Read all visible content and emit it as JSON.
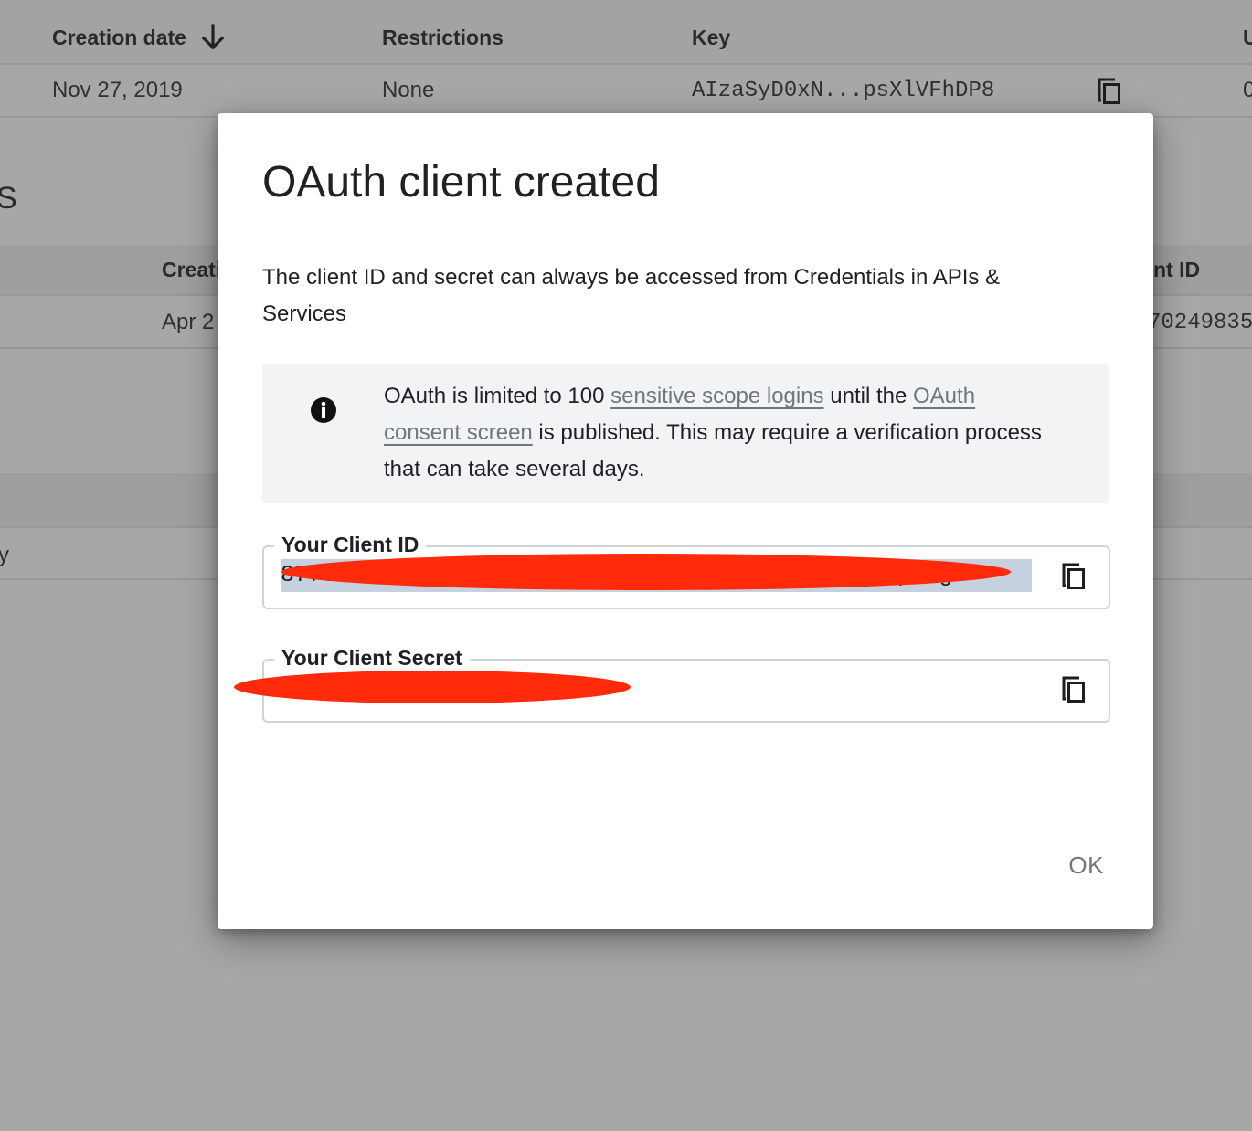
{
  "background": {
    "api_keys_table": {
      "headers": {
        "creation_date": "Creation date",
        "restrictions": "Restrictions",
        "key": "Key",
        "cut_off_column": "U"
      },
      "row": {
        "creation_date": "Nov 27, 2019",
        "restrictions": "None",
        "key": "AIzaSyD0xN...psXlVFhDP8",
        "cut_off_cell": "0"
      }
    },
    "oauth_section": {
      "title_fragment": "S",
      "headers": {
        "creation_fragment": "Creati",
        "client_id_fragment": "nt ID"
      },
      "row": {
        "creation_fragment": "Apr 2",
        "client_id_fragment": "70249835"
      }
    },
    "extra_row_fragment": "y"
  },
  "dialog": {
    "title": "OAuth client created",
    "description": "The client ID and secret can always be accessed from Credentials in APIs & Services",
    "notice": {
      "icon": "info-icon",
      "text_before_link1": "OAuth is limited to 100 ",
      "link1": "sensitive scope logins",
      "text_between": " until the ",
      "link2": "OAuth consent screen",
      "text_after": " is published. This may require a verification process that can take several days."
    },
    "client_id_field": {
      "label": "Your Client ID",
      "value": "87702•••••••••••••••••••••••••••••••••••••.apps.gc",
      "redacted": true,
      "copy_icon": "copy-icon"
    },
    "client_secret_field": {
      "label": "Your Client Secret",
      "value": "••••••••••••••••••••••••",
      "redacted": true,
      "copy_icon": "copy-icon"
    },
    "ok_label": "OK"
  },
  "colors": {
    "scrim": "#a7a7a7",
    "link": "#6f7680",
    "redaction": "#ff2a0a",
    "selection": "#c6d1e0",
    "notice_bg": "#f1f3f4"
  }
}
